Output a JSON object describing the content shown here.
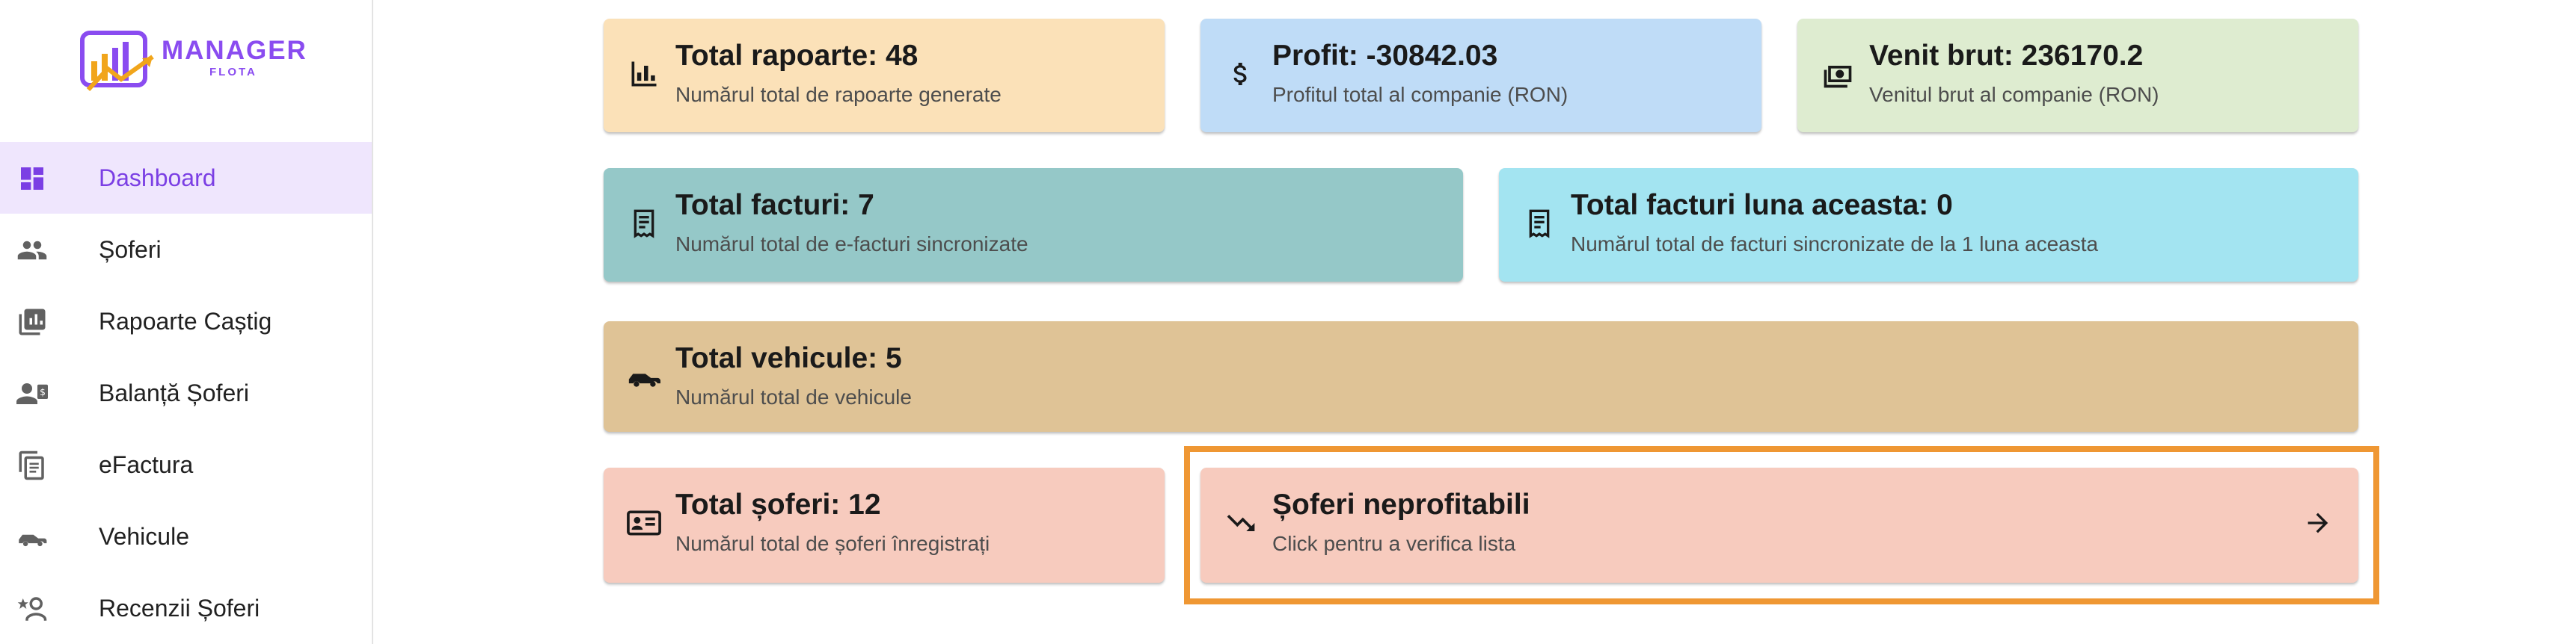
{
  "logo": {
    "main": "MANAGER",
    "sub": "FLOTA"
  },
  "sidebar": {
    "items": [
      {
        "label": "Dashboard",
        "icon": "dashboard-icon",
        "active": true
      },
      {
        "label": "Șoferi",
        "icon": "people-icon"
      },
      {
        "label": "Rapoarte Caștig",
        "icon": "reports-icon"
      },
      {
        "label": "Balanță Șoferi",
        "icon": "driver-balance-icon"
      },
      {
        "label": "eFactura",
        "icon": "document-icon"
      },
      {
        "label": "Vehicule",
        "icon": "car-icon"
      },
      {
        "label": "Recenzii Șoferi",
        "icon": "driver-review-icon"
      }
    ]
  },
  "cards": {
    "rapoarte": {
      "title": "Total rapoarte: 48",
      "subtitle": "Numărul total de rapoarte generate",
      "icon": "bar-chart-icon",
      "color": "#fbe1b8"
    },
    "profit": {
      "title": "Profit: -30842.03",
      "subtitle": "Profitul total al companie (RON)",
      "icon": "dollar-icon",
      "color": "#bfdcf7"
    },
    "venit": {
      "title": "Venit brut: 236170.2",
      "subtitle": "Venitul brut al companie (RON)",
      "icon": "money-icon",
      "color": "#deecd0"
    },
    "facturi": {
      "title": "Total facturi: 7",
      "subtitle": "Numărul total de e-facturi sincronizate",
      "icon": "receipt-icon",
      "color": "#95c8c8"
    },
    "facturi_luna": {
      "title": "Total facturi luna aceasta: 0",
      "subtitle": "Numărul total de facturi sincronizate de la 1 luna aceasta",
      "icon": "receipt-icon",
      "color": "#a3e4f1"
    },
    "vehicule": {
      "title": "Total vehicule: 5",
      "subtitle": "Numărul total de vehicule",
      "icon": "car-icon",
      "color": "#dfc396"
    },
    "soferi": {
      "title": "Total șoferi: 12",
      "subtitle": "Numărul total de șoferi înregistrați",
      "icon": "id-card-icon",
      "color": "#f7cbbe"
    },
    "neprofitabili": {
      "title": "Șoferi neprofitabili",
      "subtitle": "Click pentru a verifica lista",
      "icon": "trending-down-icon",
      "color": "#f7cbbe",
      "highlight_color": "#ef9733"
    }
  }
}
